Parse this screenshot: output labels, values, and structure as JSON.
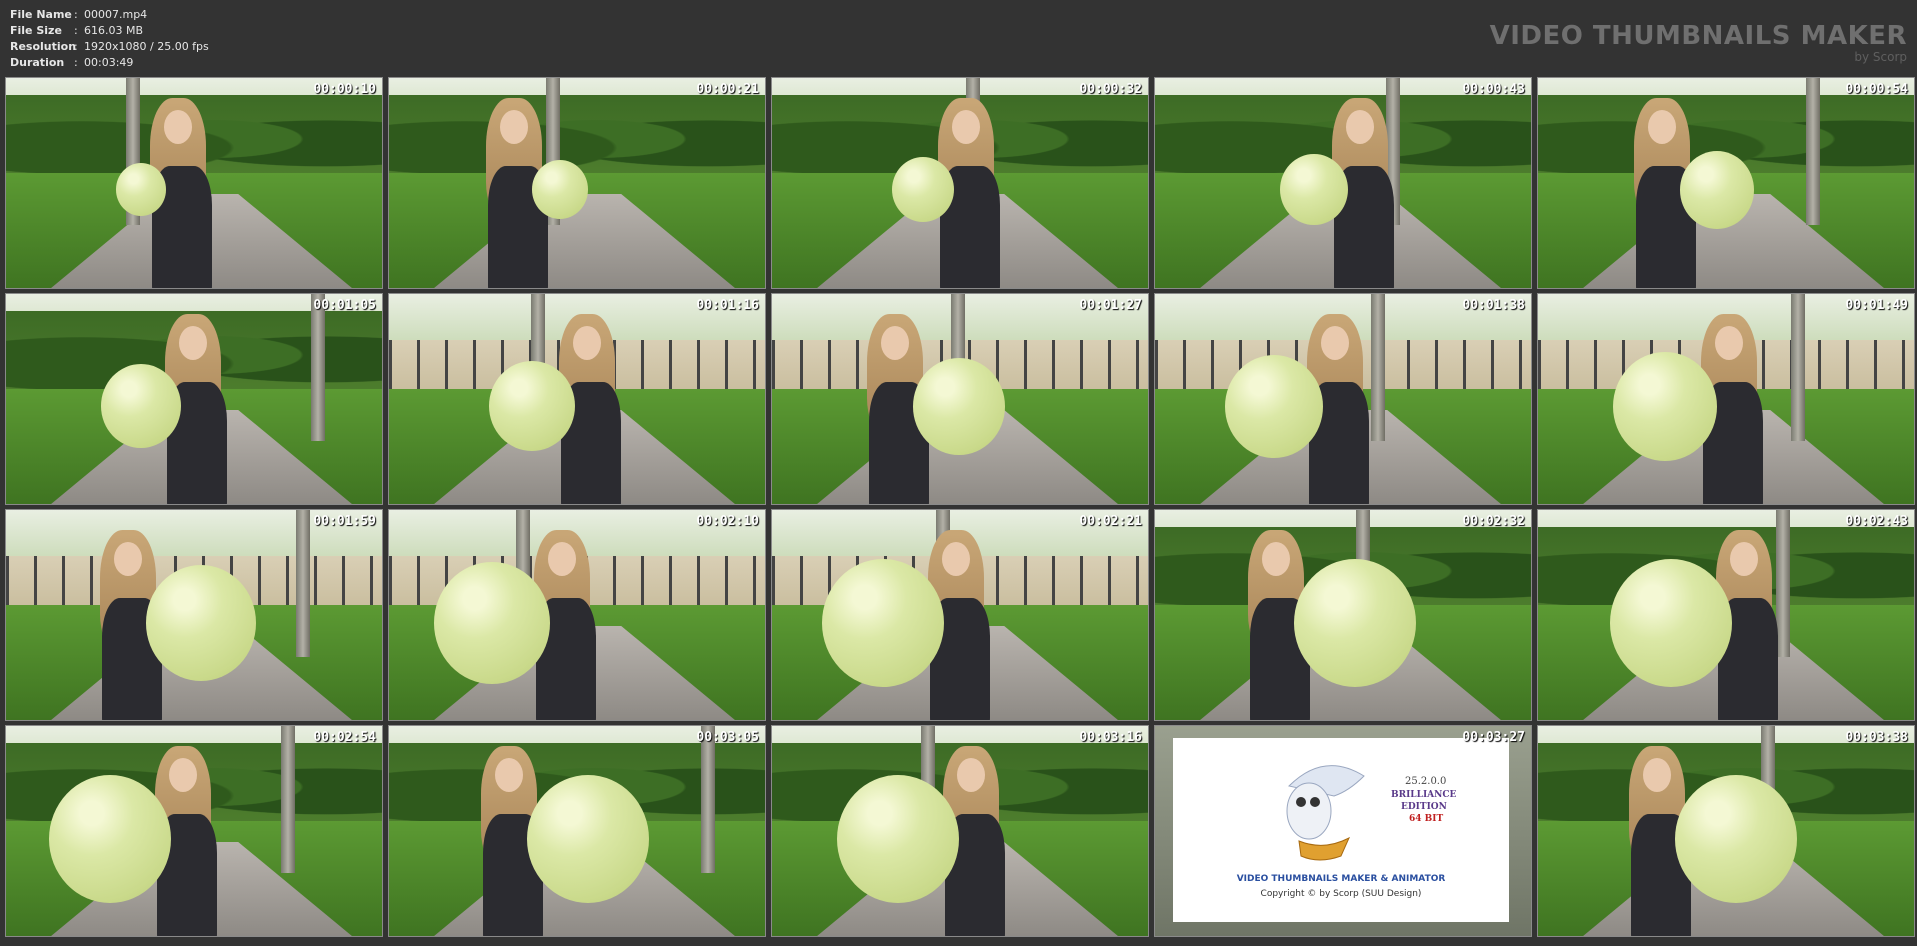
{
  "file_info": {
    "rows": [
      {
        "key": "File Name",
        "sep": ":",
        "value": "00007.mp4"
      },
      {
        "key": "File Size",
        "sep": ":",
        "value": "616.03 MB"
      },
      {
        "key": "Resolution",
        "sep": ":",
        "value": "1920x1080 / 25.00 fps"
      },
      {
        "key": "Duration",
        "sep": ":",
        "value": "00:03:49"
      }
    ]
  },
  "brand": {
    "title": "VIDEO THUMBNAILS MAKER",
    "by": "by Scorp"
  },
  "thumbnails": [
    {
      "timestamp": "00:00:10",
      "scene": "park"
    },
    {
      "timestamp": "00:00:21",
      "scene": "park"
    },
    {
      "timestamp": "00:00:32",
      "scene": "park"
    },
    {
      "timestamp": "00:00:43",
      "scene": "park"
    },
    {
      "timestamp": "00:00:54",
      "scene": "park"
    },
    {
      "timestamp": "00:01:05",
      "scene": "park"
    },
    {
      "timestamp": "00:01:16",
      "scene": "fence"
    },
    {
      "timestamp": "00:01:27",
      "scene": "fence"
    },
    {
      "timestamp": "00:01:38",
      "scene": "fence"
    },
    {
      "timestamp": "00:01:49",
      "scene": "fence"
    },
    {
      "timestamp": "00:01:59",
      "scene": "fence"
    },
    {
      "timestamp": "00:02:10",
      "scene": "fence"
    },
    {
      "timestamp": "00:02:21",
      "scene": "fence"
    },
    {
      "timestamp": "00:02:32",
      "scene": "park"
    },
    {
      "timestamp": "00:02:43",
      "scene": "park"
    },
    {
      "timestamp": "00:02:54",
      "scene": "park"
    },
    {
      "timestamp": "00:03:05",
      "scene": "park"
    },
    {
      "timestamp": "00:03:16",
      "scene": "park"
    },
    {
      "timestamp": "00:03:27",
      "scene": "logo"
    },
    {
      "timestamp": "00:03:38",
      "scene": "park"
    }
  ],
  "logo_panel": {
    "version": "25.2.0.0",
    "edition_line1": "BRILLIANCE",
    "edition_line2": "EDITION",
    "bits": "64 BIT",
    "product": "VIDEO THUMBNAILS MAKER & ANIMATOR",
    "copyright": "Copyright © by Scorp (SUU Design)"
  },
  "colors": {
    "background": "#333333",
    "balloon": "#d6e49a",
    "timestamp": "#ffffff"
  }
}
